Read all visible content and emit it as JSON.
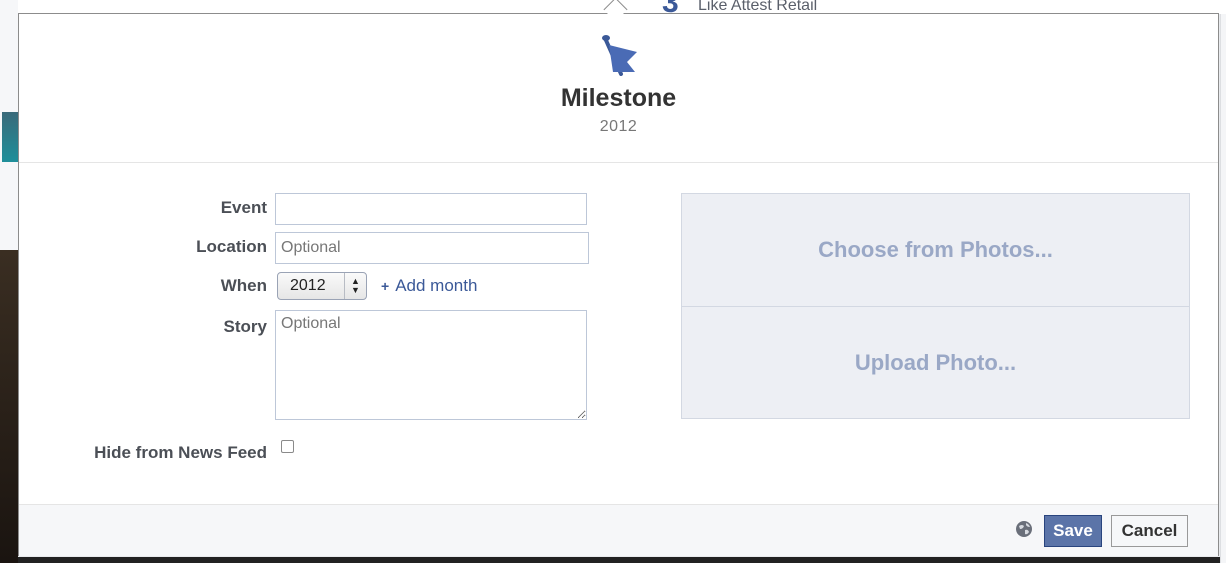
{
  "background": {
    "page_count": "3",
    "page_like_text": "Like Attest Retail"
  },
  "dialog": {
    "icon": "flag-icon",
    "title": "Milestone",
    "year": "2012"
  },
  "form": {
    "event_label": "Event",
    "event_value": "",
    "location_label": "Location",
    "location_placeholder": "Optional",
    "when_label": "When",
    "when_year": "2012",
    "add_month": "Add month",
    "story_label": "Story",
    "story_placeholder": "Optional",
    "hide_label": "Hide from News Feed",
    "hide_checked": false
  },
  "photos": {
    "choose": "Choose from Photos...",
    "upload": "Upload Photo..."
  },
  "footer": {
    "privacy_icon": "globe-icon",
    "save": "Save",
    "cancel": "Cancel"
  },
  "colors": {
    "accent": "#3b5998",
    "save_bg": "#5b74a8",
    "photo_text": "#9aa8c6"
  }
}
